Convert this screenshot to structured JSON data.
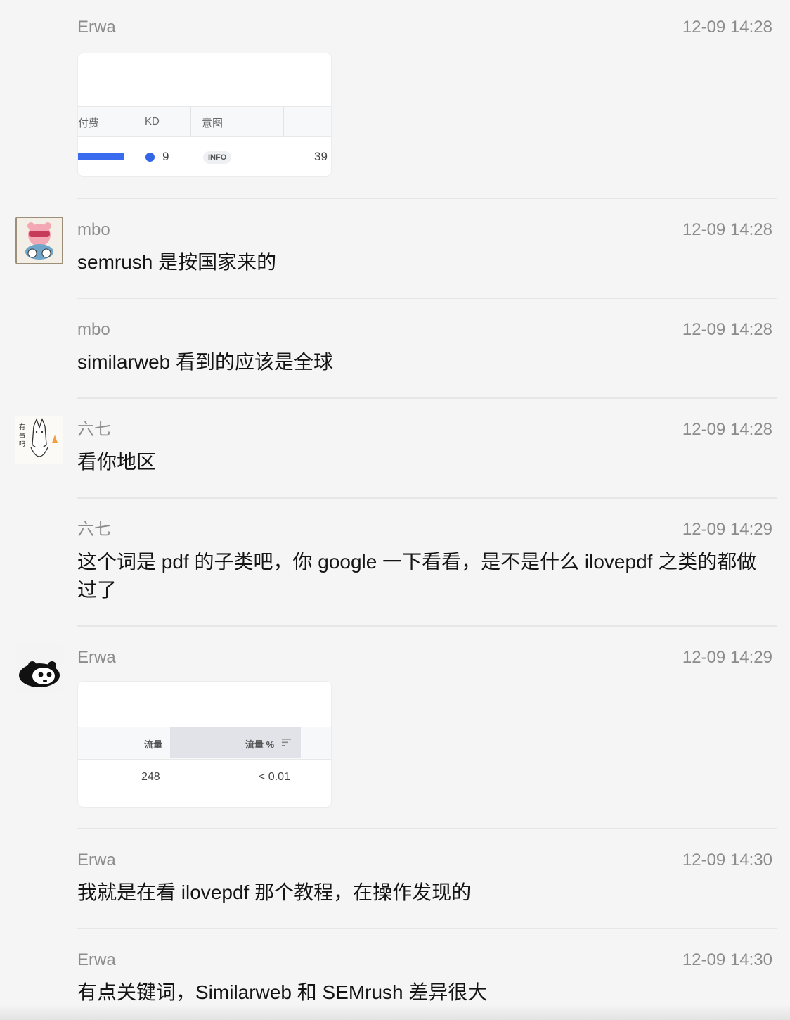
{
  "messages": [
    {
      "sender": "Erwa",
      "time": "12-09 14:28",
      "type": "image"
    },
    {
      "sender": "mbo",
      "time": "12-09 14:28",
      "text": "semrush 是按国家来的"
    },
    {
      "sender": "mbo",
      "time": "12-09 14:28",
      "text": "similarweb 看到的应该是全球"
    },
    {
      "sender": "六七",
      "time": "12-09 14:28",
      "text": "看你地区"
    },
    {
      "sender": "六七",
      "time": "12-09 14:29",
      "text": "这个词是 pdf 的子类吧，你 google 一下看看，是不是什么 ilovepdf 之类的都做过了"
    },
    {
      "sender": "Erwa",
      "time": "12-09 14:29",
      "type": "image"
    },
    {
      "sender": "Erwa",
      "time": "12-09 14:30",
      "text": "我就是在看 ilovepdf 那个教程，在操作发现的"
    },
    {
      "sender": "Erwa",
      "time": "12-09 14:30",
      "text": "有点关键词，Similarweb 和 SEMrush 差异很大"
    }
  ],
  "image1": {
    "headers": [
      "付费",
      "KD",
      "意图"
    ],
    "kd_value": "9",
    "intent_badge": "INFO",
    "trailing_value": "39",
    "colors": {
      "bar": "#3a6cf0",
      "kd_dot": "#3366e6"
    }
  },
  "image2": {
    "headers": [
      "流量",
      "流量 %"
    ],
    "values": [
      "248",
      "< 0.01"
    ],
    "sort_icon": "sort-lines-icon"
  },
  "avatars": {
    "mbo": "pink-bear-avatar-icon",
    "liuqi": "sketch-fox-avatar-icon",
    "erwa": "panda-avatar-icon"
  }
}
